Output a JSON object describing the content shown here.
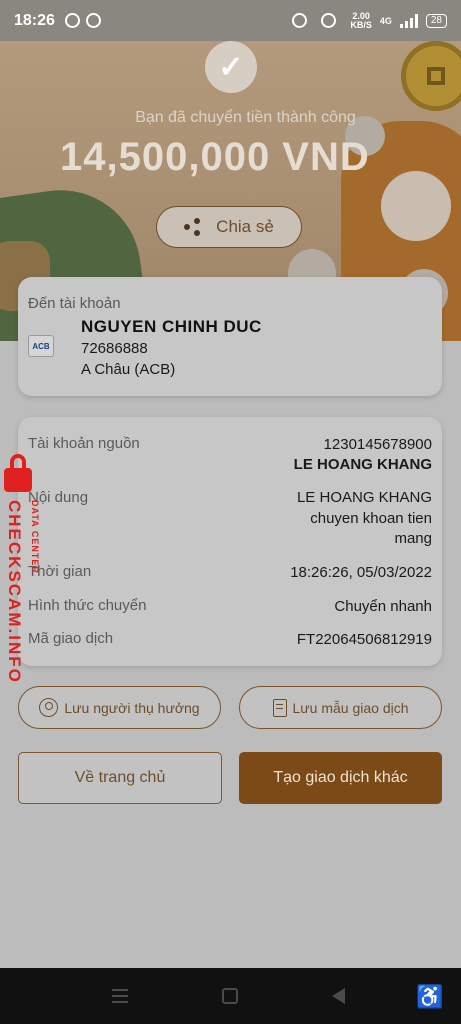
{
  "status_bar": {
    "time": "18:26",
    "speed_value": "2.00",
    "speed_unit": "KB/S",
    "network": "4G",
    "battery": "28"
  },
  "hero": {
    "success_message": "Bạn đã chuyển tiền thành công",
    "amount": "14,500,000 VND",
    "share_label": "Chia sẻ"
  },
  "destination": {
    "label": "Đến tài khoản",
    "bank_logo_text": "ACB",
    "name": "NGUYEN CHINH DUC",
    "account_number": "72686888",
    "bank_name": "A Châu (ACB)"
  },
  "details": {
    "source_label": "Tài khoản nguồn",
    "source_account": "1230145678900",
    "source_name": "LE HOANG KHANG",
    "content_label": "Nội dung",
    "content_line1": "LE HOANG KHANG",
    "content_line2": "chuyen khoan tien",
    "content_line3": "mang",
    "time_label": "Thời gian",
    "time_value": "18:26:26, 05/03/2022",
    "method_label": "Hình thức chuyển",
    "method_value": "Chuyển nhanh",
    "tx_code_label": "Mã giao dịch",
    "tx_code_value": "FT22064506812919"
  },
  "watermark": {
    "main": "CHECKSCAM.INFO",
    "sub": "DATA CENTER"
  },
  "actions": {
    "save_beneficiary": "Lưu người thụ hưởng",
    "save_template": "Lưu mẫu giao dịch",
    "home": "Về trang chủ",
    "new_transaction": "Tạo giao dịch khác"
  }
}
